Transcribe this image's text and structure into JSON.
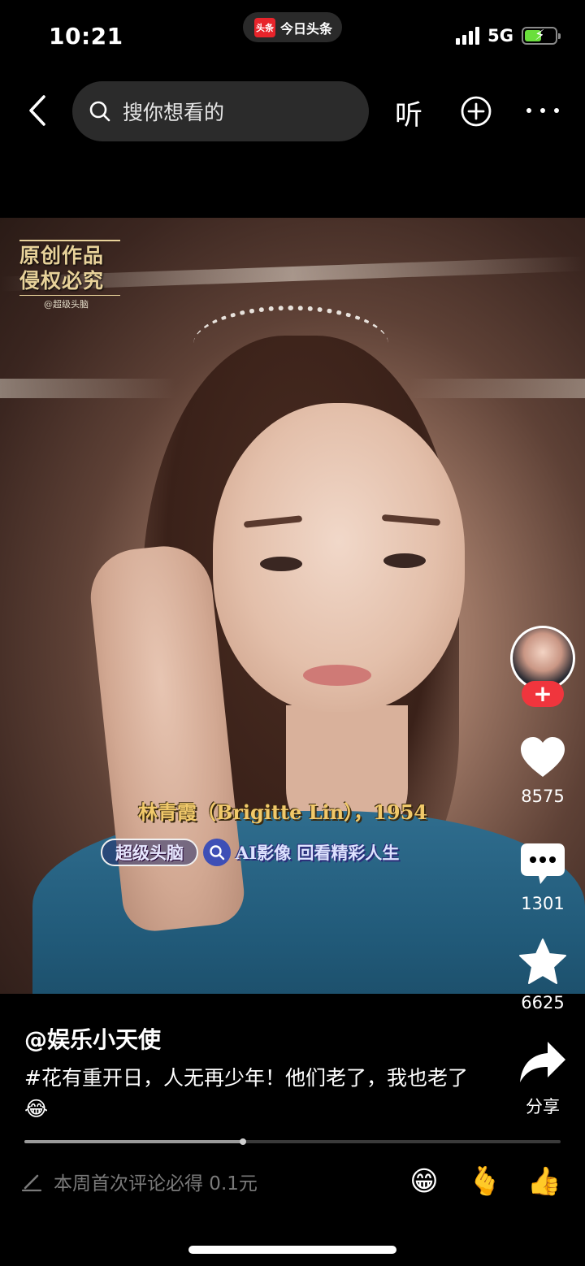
{
  "status_bar": {
    "time": "10:21",
    "app_pill": {
      "logo_text": "头条",
      "label": "今日头条"
    },
    "network": "5G",
    "battery_level": 0.55,
    "battery_color": "#6adf3c"
  },
  "top_bar": {
    "search_placeholder": "搜你想看的",
    "listen_label": "听"
  },
  "video": {
    "watermark": {
      "line1": "原创作品",
      "line2": "侵权必究",
      "handle": "@超级头脑"
    },
    "caption": {
      "name_line": "林青霞（Brigitte Lin），1954",
      "tag_label": "超级头脑",
      "slogan": "AI影像 回看精彩人生"
    }
  },
  "actions": {
    "follow_symbol": "+",
    "likes": "8575",
    "comments": "1301",
    "favorites": "6625",
    "share_label": "分享",
    "accent_color": "#f0353d"
  },
  "post": {
    "author": "@娱乐小天使",
    "description": "#花有重开日，人无再少年！他们老了，我也老了",
    "description_emoji": "😂"
  },
  "playback": {
    "progress": 0.407
  },
  "comment_bar": {
    "placeholder": "本周首次评论必得 0.1元",
    "quick_emojis": [
      "😁",
      "🫰",
      "👍"
    ]
  }
}
